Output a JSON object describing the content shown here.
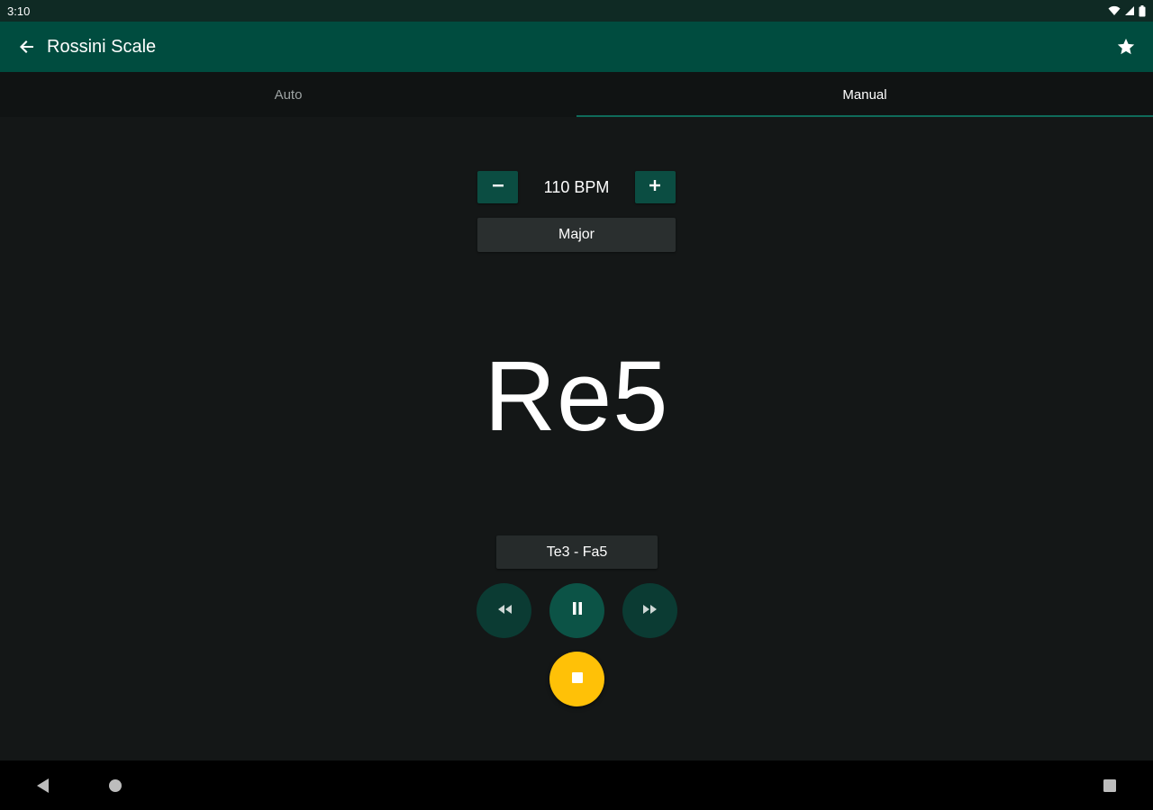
{
  "status_bar": {
    "time": "3:10",
    "icons": [
      "wifi-icon",
      "signal-icon",
      "battery-icon"
    ]
  },
  "app_bar": {
    "title": "Rossini Scale",
    "back_icon": "arrow-left-icon",
    "favorite_icon": "star-icon"
  },
  "tabs": [
    {
      "label": "Auto",
      "active": false
    },
    {
      "label": "Manual",
      "active": true
    }
  ],
  "tempo": {
    "decrement_icon": "minus-icon",
    "value_label": "110 BPM",
    "increment_icon": "plus-icon"
  },
  "scale_type": {
    "selected": "Major"
  },
  "current_note": "Re5",
  "range": {
    "label": "Te3 - Fa5"
  },
  "playback": {
    "rewind_icon": "rewind-icon",
    "pause_icon": "pause-icon",
    "forward_icon": "fast-forward-icon",
    "stop_icon": "stop-icon"
  },
  "nav_bar": {
    "back_icon": "nav-back-icon",
    "home_icon": "nav-home-icon",
    "recents_icon": "nav-recents-icon"
  },
  "colors": {
    "status_bar": "#0f2a24",
    "app_bar": "#004c3f",
    "background": "#141717",
    "tab_indicator": "#0f6b5a",
    "accent_button": "#0b4d42",
    "stop_button": "#ffc107"
  }
}
